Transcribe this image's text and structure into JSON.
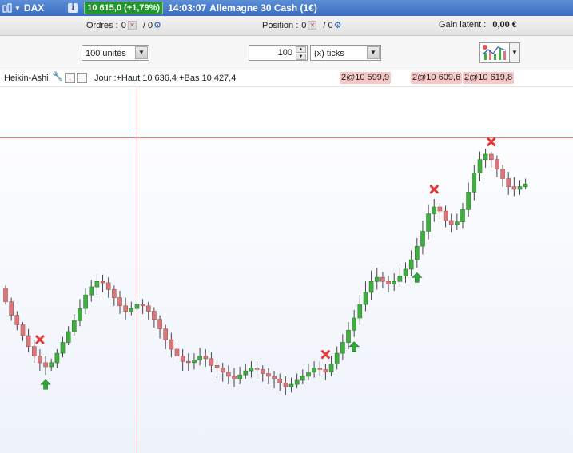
{
  "titlebar": {
    "instrument": "DAX",
    "info_icon": "i",
    "price": "10 615,0 (+1,79%)",
    "time": "14:03:07",
    "name": "Allemagne 30 Cash (1€)"
  },
  "status": {
    "orders_label": "Ordres :",
    "orders_value": "0",
    "orders_total": "/ 0",
    "position_label": "Position :",
    "position_value": "0",
    "position_total": "/ 0",
    "gain_label": "Gain latent :",
    "gain_value": "0,00 €"
  },
  "toolbar": {
    "units": "100 unités",
    "ticks_value": "100",
    "ticks_unit": "(x) ticks"
  },
  "indicator": {
    "name": "Heikin-Ashi",
    "info": "Jour :+Haut 10 636,4 +Bas 10 427,4",
    "tags": [
      "2@10 599,9",
      "2@10 609,6",
      "2@10 619,8"
    ]
  },
  "colors": {
    "up": "#3fae3f",
    "down": "#d9787b",
    "crosshair": "#e05555"
  },
  "chart_data": {
    "type": "candlestick",
    "chart_style": "Heikin-Ashi",
    "candles": [
      [
        10535,
        10525,
        10537,
        10523
      ],
      [
        10525,
        10515,
        10528,
        10511
      ],
      [
        10515,
        10508,
        10518,
        10504
      ],
      [
        10508,
        10500,
        10510,
        10496
      ],
      [
        10500,
        10492,
        10505,
        10488
      ],
      [
        10492,
        10485,
        10497,
        10480
      ],
      [
        10485,
        10480,
        10490,
        10474
      ],
      [
        10480,
        10477,
        10485,
        10471
      ],
      [
        10477,
        10480,
        10483,
        10474
      ],
      [
        10480,
        10487,
        10490,
        10476
      ],
      [
        10487,
        10495,
        10499,
        10484
      ],
      [
        10495,
        10503,
        10507,
        10493
      ],
      [
        10503,
        10511,
        10516,
        10500
      ],
      [
        10511,
        10520,
        10527,
        10507
      ],
      [
        10520,
        10530,
        10535,
        10516
      ],
      [
        10530,
        10536,
        10541,
        10525
      ],
      [
        10536,
        10540,
        10545,
        10530
      ],
      [
        10540,
        10539,
        10545,
        10532
      ],
      [
        10539,
        10534,
        10543,
        10528
      ],
      [
        10534,
        10528,
        10537,
        10522
      ],
      [
        10528,
        10522,
        10533,
        10516
      ],
      [
        10522,
        10518,
        10528,
        10512
      ],
      [
        10518,
        10520,
        10525,
        10515
      ],
      [
        10520,
        10523,
        10527,
        10518
      ],
      [
        10523,
        10522,
        10527,
        10516
      ],
      [
        10522,
        10518,
        10525,
        10512
      ],
      [
        10518,
        10512,
        10521,
        10506
      ],
      [
        10512,
        10505,
        10515,
        10498
      ],
      [
        10505,
        10497,
        10508,
        10490
      ],
      [
        10497,
        10490,
        10502,
        10484
      ],
      [
        10490,
        10485,
        10495,
        10479
      ],
      [
        10485,
        10481,
        10490,
        10474
      ],
      [
        10481,
        10480,
        10487,
        10474
      ],
      [
        10480,
        10482,
        10487,
        10475
      ],
      [
        10482,
        10485,
        10491,
        10478
      ],
      [
        10485,
        10483,
        10490,
        10477
      ],
      [
        10483,
        10478,
        10488,
        10473
      ],
      [
        10478,
        10476,
        10482,
        10469
      ],
      [
        10476,
        10473,
        10480,
        10466
      ],
      [
        10473,
        10470,
        10478,
        10464
      ],
      [
        10470,
        10468,
        10476,
        10462
      ],
      [
        10468,
        10471,
        10477,
        10464
      ],
      [
        10471,
        10474,
        10479,
        10468
      ],
      [
        10474,
        10476,
        10481,
        10469
      ],
      [
        10476,
        10475,
        10481,
        10468
      ],
      [
        10475,
        10472,
        10478,
        10466
      ],
      [
        10472,
        10470,
        10476,
        10464
      ],
      [
        10470,
        10468,
        10474,
        10461
      ],
      [
        10468,
        10465,
        10472,
        10459
      ],
      [
        10465,
        10462,
        10470,
        10456
      ],
      [
        10462,
        10464,
        10469,
        10458
      ],
      [
        10464,
        10467,
        10472,
        10461
      ],
      [
        10467,
        10470,
        10475,
        10464
      ],
      [
        10470,
        10473,
        10479,
        10467
      ],
      [
        10473,
        10476,
        10481,
        10469
      ],
      [
        10476,
        10475,
        10481,
        10470
      ],
      [
        10475,
        10473,
        10479,
        10467
      ],
      [
        10473,
        10479,
        10485,
        10470
      ],
      [
        10479,
        10487,
        10492,
        10475
      ],
      [
        10487,
        10495,
        10501,
        10482
      ],
      [
        10495,
        10504,
        10510,
        10490
      ],
      [
        10504,
        10513,
        10519,
        10499
      ],
      [
        10513,
        10523,
        10530,
        10508
      ],
      [
        10523,
        10532,
        10540,
        10518
      ],
      [
        10532,
        10540,
        10548,
        10526
      ],
      [
        10540,
        10543,
        10550,
        10534
      ],
      [
        10543,
        10540,
        10547,
        10535
      ],
      [
        10540,
        10538,
        10544,
        10532
      ],
      [
        10538,
        10540,
        10546,
        10533
      ],
      [
        10540,
        10544,
        10550,
        10536
      ],
      [
        10544,
        10549,
        10554,
        10539
      ],
      [
        10549,
        10556,
        10563,
        10544
      ],
      [
        10556,
        10566,
        10572,
        10550
      ],
      [
        10566,
        10577,
        10585,
        10560
      ],
      [
        10577,
        10590,
        10597,
        10571
      ],
      [
        10590,
        10595,
        10601,
        10584
      ],
      [
        10595,
        10592,
        10598,
        10586
      ],
      [
        10592,
        10585,
        10596,
        10580
      ],
      [
        10585,
        10582,
        10590,
        10576
      ],
      [
        10582,
        10584,
        10590,
        10578
      ],
      [
        10584,
        10593,
        10598,
        10579
      ],
      [
        10593,
        10606,
        10613,
        10588
      ],
      [
        10606,
        10620,
        10626,
        10600
      ],
      [
        10620,
        10630,
        10636,
        10614
      ],
      [
        10630,
        10634,
        10638,
        10624
      ],
      [
        10634,
        10630,
        10636,
        10624
      ],
      [
        10630,
        10623,
        10633,
        10617
      ],
      [
        10623,
        10616,
        10626,
        10610
      ],
      [
        10616,
        10610,
        10621,
        10604
      ],
      [
        10610,
        10608,
        10617,
        10603
      ],
      [
        10608,
        10610,
        10615,
        10604
      ],
      [
        10610,
        10612,
        10616,
        10608
      ]
    ],
    "exits": [
      6,
      56,
      75,
      85
    ],
    "entries": [
      7,
      61,
      72
    ],
    "crosshair_x": 23,
    "crosshair_y": 10646,
    "ylim": [
      10418,
      10680
    ]
  }
}
